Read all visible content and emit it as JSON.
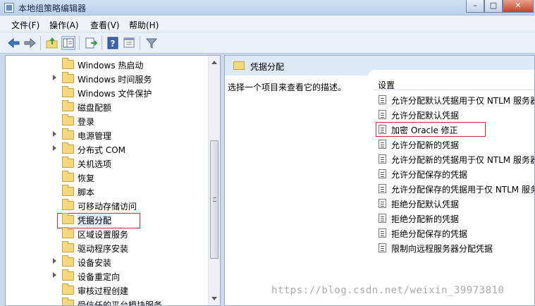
{
  "window": {
    "title": "本地组策略编辑器"
  },
  "menu": [
    "文件(F)",
    "操作(A)",
    "查看(V)",
    "帮助(H)"
  ],
  "toolbar": {
    "icons": [
      "back-icon",
      "forward-icon",
      "up-folder-icon",
      "show-hide-tree-icon",
      "export-list-icon",
      "help-icon",
      "properties-icon",
      "filter-icon"
    ]
  },
  "tree": {
    "items": [
      {
        "label": "Windows 热启动",
        "expandable": false
      },
      {
        "label": "Windows 时间服务",
        "expandable": true
      },
      {
        "label": "Windows 文件保护",
        "expandable": false
      },
      {
        "label": "磁盘配额",
        "expandable": false
      },
      {
        "label": "登录",
        "expandable": false
      },
      {
        "label": "电源管理",
        "expandable": true
      },
      {
        "label": "分布式 COM",
        "expandable": true
      },
      {
        "label": "关机选项",
        "expandable": false
      },
      {
        "label": "恢复",
        "expandable": false
      },
      {
        "label": "脚本",
        "expandable": false
      },
      {
        "label": "可移动存储访问",
        "expandable": false
      },
      {
        "label": "凭据分配",
        "expandable": false,
        "selected": true
      },
      {
        "label": "区域设置服务",
        "expandable": false
      },
      {
        "label": "驱动程序安装",
        "expandable": false
      },
      {
        "label": "设备安装",
        "expandable": true
      },
      {
        "label": "设备重定向",
        "expandable": true
      },
      {
        "label": "审核过程创建",
        "expandable": false
      },
      {
        "label": "受信任的平台模块服务",
        "expandable": false
      }
    ]
  },
  "right": {
    "header": "凭据分配",
    "description": "选择一个项目来查看它的描述。",
    "settings_header": "设置",
    "settings": [
      "允许分配默认凭据用于仅 NTLM 服务器",
      "允许分配默认凭据",
      "加密 Oracle 修正",
      "允许分配新的凭据",
      "允许分配新的凭据用于仅 NTLM 服务器",
      "允许分配保存的凭据",
      "允许分配保存的凭据用于仅 NTLM 服务",
      "拒绝分配默认凭据",
      "拒绝分配新的凭据",
      "拒绝分配保存的凭据",
      "限制向远程服务器分配凭据"
    ]
  },
  "watermark": "https://blog.csdn.net/weixin_39973810"
}
